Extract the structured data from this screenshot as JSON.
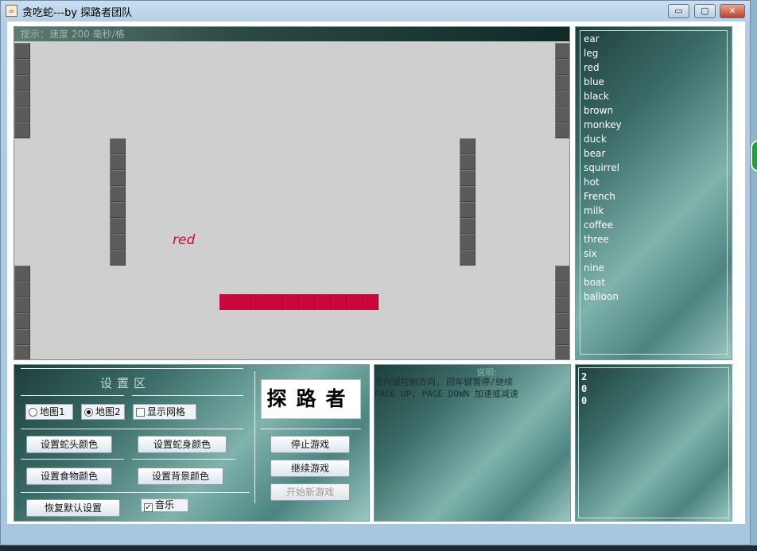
{
  "window": {
    "title": "贪吃蛇---by 探路者团队",
    "icon": "java-cup-icon",
    "min_label": "▭",
    "max_label": "▢",
    "close_label": "✕"
  },
  "board": {
    "hint_prefix": "提示：",
    "hint_text": "速度 200 毫秒/格",
    "food_word": "red",
    "colors": {
      "snake": "#c8083c",
      "wall": "#5b5b5b",
      "background": "#cfcfcf"
    }
  },
  "words": [
    "ear",
    "leg",
    "red",
    "blue",
    "black",
    "brown",
    "monkey",
    "duck",
    "bear",
    "squirrel",
    "hot",
    "French",
    "milk",
    "coffee",
    "three",
    "six",
    "nine",
    "boat",
    "balloon"
  ],
  "settings": {
    "title": "设置区",
    "map1": "地图1",
    "map2": "地图2",
    "show_grid": "显示网格",
    "snake_head_color": "设置蛇头颜色",
    "snake_body_color": "设置蛇身颜色",
    "food_color": "设置食物颜色",
    "bg_color": "设置背景颜色",
    "restore_default": "恢复默认设置",
    "music": "音乐",
    "stop_game": "停止游戏",
    "continue_game": "继续游戏",
    "new_game": "开始新游戏",
    "logo_text": "探路者"
  },
  "help": {
    "heading": "说明:",
    "line1": "方向键控制方向, 回车键暂停/继续",
    "line2": "PAGE UP, PAGE DOWN 加速或减速"
  },
  "score": {
    "value": "200"
  }
}
